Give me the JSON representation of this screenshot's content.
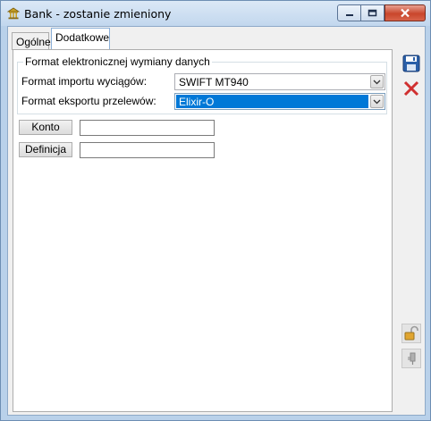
{
  "window": {
    "title": "Bank - zostanie zmieniony",
    "icon": "bank-icon"
  },
  "tabs": [
    {
      "label": "Ogólne",
      "active": false
    },
    {
      "label": "Dodatkowe",
      "active": true
    }
  ],
  "group": {
    "title": "Format elektronicznej wymiany danych",
    "import_label": "Format importu wyciągów:",
    "import_value": "SWIFT MT940",
    "export_label": "Format eksportu przelewów:",
    "export_value": "Elixir-O"
  },
  "fields": {
    "konto_button": "Konto",
    "konto_value": "",
    "definicja_button": "Definicja",
    "definicja_value": ""
  },
  "side_toolbar": {
    "save_icon": "save-icon",
    "cancel_icon": "cancel-icon",
    "lock_icon": "padlock-icon",
    "attach_icon": "pin-icon"
  },
  "colors": {
    "selection": "#0078d7",
    "cancel": "#d03030",
    "save": "#2a5fa8"
  }
}
